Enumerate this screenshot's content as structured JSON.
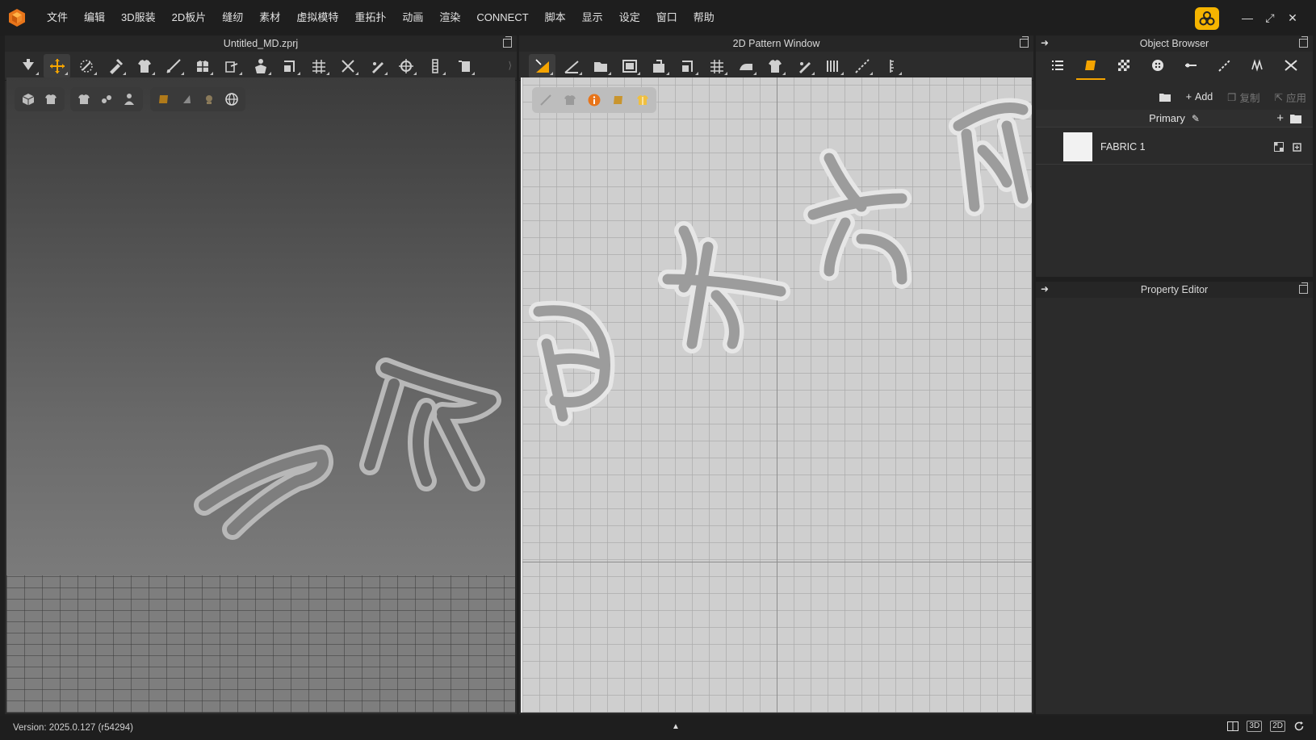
{
  "menu": {
    "items": [
      "文件",
      "编辑",
      "3D服装",
      "2D板片",
      "缝纫",
      "素材",
      "虚拟模特",
      "重拓扑",
      "动画",
      "渲染",
      "CONNECT",
      "脚本",
      "显示",
      "设定",
      "窗口",
      "帮助"
    ]
  },
  "window_controls": {
    "minimize": "—",
    "maximize": "⤢",
    "close": "✕"
  },
  "panels": {
    "viewport3d": {
      "title": "Untitled_MD.zprj"
    },
    "pattern2d": {
      "title": "2D Pattern Window"
    },
    "object_browser": {
      "title": "Object Browser"
    },
    "property_editor": {
      "title": "Property Editor"
    }
  },
  "object_browser": {
    "actions": {
      "add": "Add",
      "copy": "复制",
      "apply": "应用"
    },
    "group_label": "Primary",
    "fabrics": [
      {
        "name": "FABRIC 1",
        "color": "#f2f2f2"
      }
    ]
  },
  "status": {
    "version": "Version: 2025.0.127 (r54294)",
    "caret": "▲",
    "btn_3d": "3D",
    "btn_2d": "2D"
  },
  "colors": {
    "accent": "#f5a400",
    "brand": "#f5b400"
  }
}
